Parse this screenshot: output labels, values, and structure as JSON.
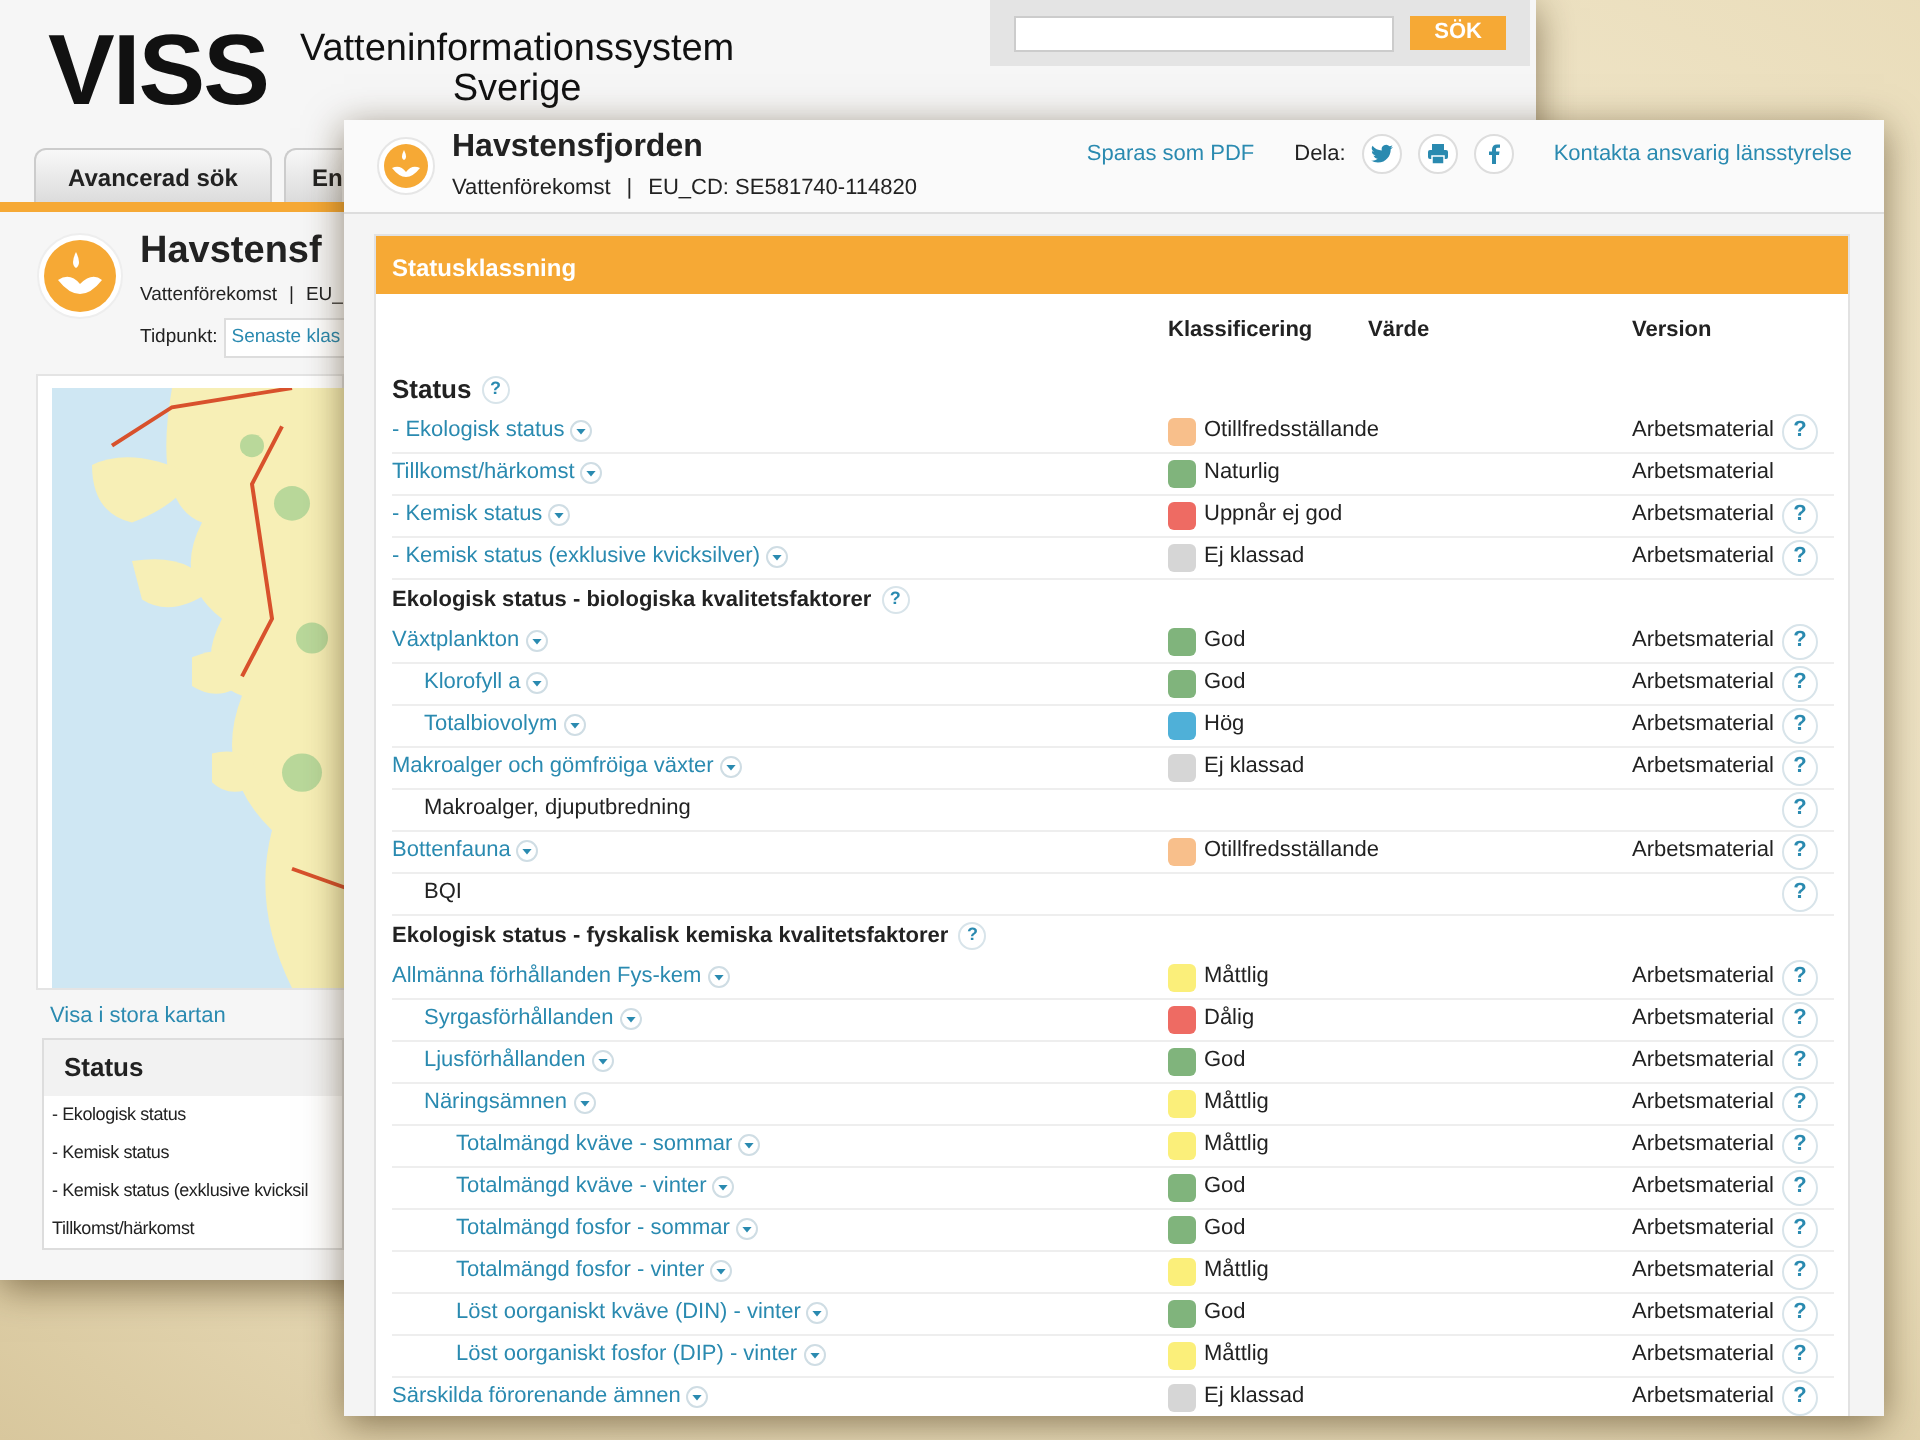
{
  "back_window": {
    "logo": "VISS",
    "logo_subtitle_line_1": "Vatteninformationssystem",
    "logo_subtitle_line_2": "Sverige",
    "search": {
      "button": "SÖK"
    },
    "tabs": [
      {
        "label": "Avancerad sök",
        "selected": false
      },
      {
        "label": "En",
        "selected": false
      }
    ],
    "title": "Havstensf",
    "subtitle_type": "Vattenförekomst",
    "subtitle_separator": "|",
    "subtitle_code": "EU_",
    "time_label": "Tidpunkt:",
    "time_value": "Senaste klas",
    "map_link": "Visa i stora kartan",
    "status_panel": {
      "title": "Status",
      "items": [
        "- Ekologisk status",
        "- Kemisk status",
        "- Kemisk status (exklusive kvicksil",
        "Tillkomst/härkomst"
      ]
    }
  },
  "front_window": {
    "title": "Havstensfjorden",
    "subtitle_type": "Vattenförekomst",
    "subtitle_separator": "|",
    "subtitle_code": "EU_CD: SE581740-114820",
    "actions": {
      "pdf": "Sparas som PDF",
      "share_label": "Dela:",
      "contact": "Kontakta ansvarig länsstyrelse"
    },
    "panel": {
      "title": "Statusklassning",
      "columns": [
        "Klassificering",
        "Värde",
        "Version"
      ],
      "sections": [
        {
          "title": "Status",
          "kind": "main",
          "help": "?",
          "rows": [
            {
              "label": "- Ekologisk status",
              "kind": "link",
              "classification": "Otillfredsställande",
              "color": "#f8bf8b",
              "version": "Arbetsmaterial",
              "help": "?"
            },
            {
              "label": "Tillkomst/härkomst",
              "kind": "link",
              "classification": "Naturlig",
              "color": "#80b47c",
              "version": "Arbetsmaterial"
            },
            {
              "label": "- Kemisk status",
              "kind": "link",
              "classification": "Uppnår ej god",
              "color": "#ee6b63",
              "version": "Arbetsmaterial",
              "help": "?"
            },
            {
              "label": "- Kemisk status (exklusive kvicksilver)",
              "kind": "link",
              "classification": "Ej klassad",
              "color": "#d6d6d6",
              "version": "Arbetsmaterial",
              "help": "?"
            }
          ]
        },
        {
          "title": "Ekologisk status - biologiska kvalitetsfaktorer",
          "kind": "sub",
          "help": "?",
          "rows": [
            {
              "label": "Växtplankton",
              "kind": "link",
              "classification": "God",
              "color": "#80b47c",
              "version": "Arbetsmaterial",
              "help": "?",
              "children": [
                {
                  "label": "Klorofyll a",
                  "kind": "link",
                  "classification": "God",
                  "color": "#80b47c",
                  "version": "Arbetsmaterial",
                  "help": "?"
                },
                {
                  "label": "Totalbiovolym",
                  "kind": "link",
                  "classification": "Hög",
                  "color": "#4fb0d8",
                  "version": "Arbetsmaterial",
                  "help": "?"
                }
              ]
            },
            {
              "label": "Makroalger och gömfröiga växter",
              "kind": "link",
              "classification": "Ej klassad",
              "color": "#d6d6d6",
              "version": "Arbetsmaterial",
              "help": "?",
              "children": [
                {
                  "label": "Makroalger, djuputbredning",
                  "kind": "plain",
                  "help": "?"
                }
              ]
            },
            {
              "label": "Bottenfauna",
              "kind": "link",
              "classification": "Otillfredsställande",
              "color": "#f8bf8b",
              "version": "Arbetsmaterial",
              "help": "?",
              "children": [
                {
                  "label": "BQI",
                  "kind": "plain",
                  "help": "?"
                }
              ]
            }
          ]
        },
        {
          "title": "Ekologisk status - fyskalisk kemiska kvalitetsfaktorer",
          "kind": "sub",
          "help": "?",
          "rows": [
            {
              "label": "Allmänna förhållanden Fys-kem",
              "kind": "link",
              "classification": "Måttlig",
              "color": "#fbef7a",
              "version": "Arbetsmaterial",
              "help": "?",
              "children": [
                {
                  "label": "Syrgasförhållanden",
                  "kind": "link",
                  "classification": "Dålig",
                  "color": "#ee6b63",
                  "version": "Arbetsmaterial",
                  "help": "?"
                },
                {
                  "label": "Ljusförhållanden",
                  "kind": "link",
                  "classification": "God",
                  "color": "#80b47c",
                  "version": "Arbetsmaterial",
                  "help": "?"
                },
                {
                  "label": "Näringsämnen",
                  "kind": "link",
                  "classification": "Måttlig",
                  "color": "#fbef7a",
                  "version": "Arbetsmaterial",
                  "help": "?",
                  "children": [
                    {
                      "label": "Totalmängd kväve - sommar",
                      "kind": "link",
                      "classification": "Måttlig",
                      "color": "#fbef7a",
                      "version": "Arbetsmaterial",
                      "help": "?"
                    },
                    {
                      "label": "Totalmängd kväve - vinter",
                      "kind": "link",
                      "classification": "God",
                      "color": "#80b47c",
                      "version": "Arbetsmaterial",
                      "help": "?"
                    },
                    {
                      "label": "Totalmängd fosfor - sommar",
                      "kind": "link",
                      "classification": "God",
                      "color": "#80b47c",
                      "version": "Arbetsmaterial",
                      "help": "?"
                    },
                    {
                      "label": "Totalmängd fosfor - vinter",
                      "kind": "link",
                      "classification": "Måttlig",
                      "color": "#fbef7a",
                      "version": "Arbetsmaterial",
                      "help": "?"
                    },
                    {
                      "label": "Löst oorganiskt kväve (DIN) - vinter",
                      "kind": "link",
                      "classification": "God",
                      "color": "#80b47c",
                      "version": "Arbetsmaterial",
                      "help": "?"
                    },
                    {
                      "label": "Löst oorganiskt fosfor (DIP) - vinter",
                      "kind": "link",
                      "classification": "Måttlig",
                      "color": "#fbef7a",
                      "version": "Arbetsmaterial",
                      "help": "?"
                    }
                  ]
                }
              ]
            },
            {
              "label": "Särskilda förorenande ämnen",
              "kind": "link",
              "classification": "Ej klassad",
              "color": "#d6d6d6",
              "version": "Arbetsmaterial",
              "help": "?"
            }
          ]
        }
      ]
    }
  }
}
